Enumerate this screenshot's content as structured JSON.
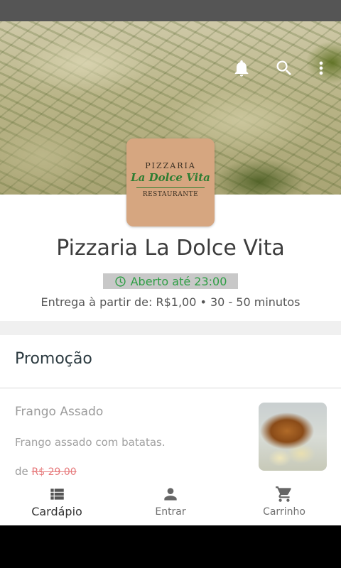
{
  "restaurant": {
    "name": "Pizzaria La Dolce Vita",
    "logo": {
      "line1": "PIZZARIA",
      "line2": "La Dolce Vita",
      "line3": "RESTAURANTE"
    },
    "status": "Aberto até 23:00",
    "delivery": "Entrega à partir de: R$1,00 • 30 - 50 minutos"
  },
  "header_icons": [
    "bell-icon",
    "search-icon",
    "more-vert-icon"
  ],
  "section": {
    "title": "Promoção"
  },
  "item": {
    "name": "Frango Assado",
    "description": "Frango assado com batatas.",
    "price_prefix": "de",
    "old_price": "R$ 29.00"
  },
  "nav": [
    {
      "label": "Cardápio",
      "icon": "list-icon",
      "active": true
    },
    {
      "label": "Entrar",
      "icon": "person-icon",
      "active": false
    },
    {
      "label": "Carrinho",
      "icon": "cart-icon",
      "active": false
    }
  ],
  "colors": {
    "status_text": "#2e9e44",
    "status_bg": "#c8c8c8",
    "old_price": "#e6787a",
    "logo_bg": "#d6a680"
  }
}
